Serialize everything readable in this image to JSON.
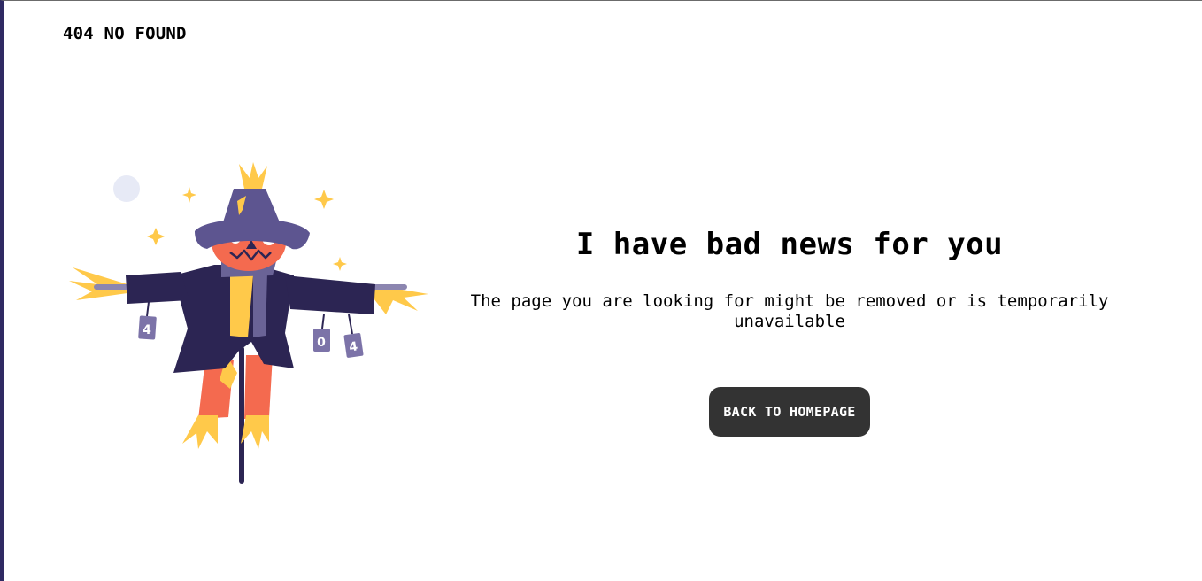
{
  "header": {
    "brand": "404 NO FOUND"
  },
  "illustration": {
    "name": "scarecrow-illustration",
    "can_labels": [
      "4",
      "0",
      "4"
    ]
  },
  "main": {
    "headline": "I have bad news for you",
    "message": "The page you are looking for might be removed or is temporarily unavailable",
    "button_label": "BACK TO HOMEPAGE"
  },
  "colors": {
    "frame_left": "#2f2a63",
    "button_bg": "#333333",
    "hat": "#5d5590",
    "coat": "#2c2553",
    "pumpkin": "#f46a4f",
    "straw": "#ffc94a",
    "can": "#7c73a8",
    "moon": "#e7eaf6"
  }
}
